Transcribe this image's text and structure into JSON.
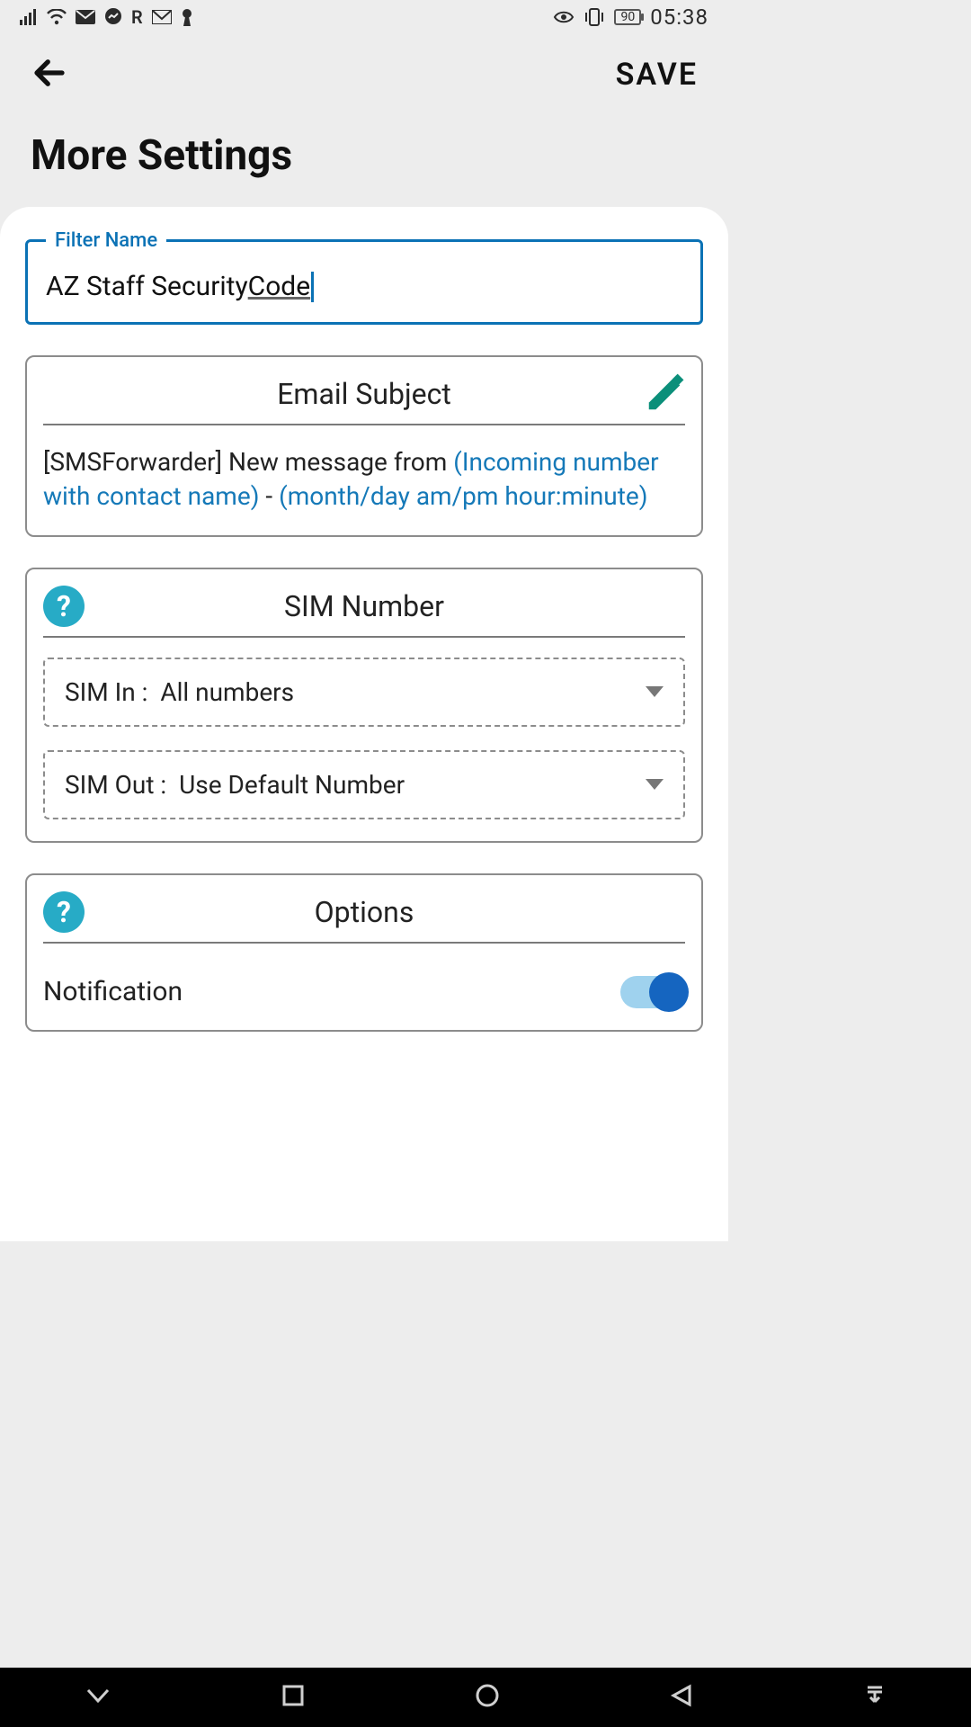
{
  "status_bar": {
    "battery": "90",
    "clock": "05:38",
    "roaming": "R"
  },
  "app_bar": {
    "save_label": "SAVE"
  },
  "page": {
    "title": "More Settings"
  },
  "filter": {
    "legend": "Filter Name",
    "value_prefix": "AZ Staff Security ",
    "value_underlined": "Code"
  },
  "email_subject": {
    "title": "Email Subject",
    "prefix": "[SMSForwarder] New message from ",
    "token1": "(Incoming number with contact name)",
    "sep": " - ",
    "token2": "(month/day am/pm hour:minute)"
  },
  "sim": {
    "title": "SIM Number",
    "in_label": "SIM In :",
    "in_value": "All numbers",
    "out_label": "SIM Out :",
    "out_value": "Use Default Number"
  },
  "options": {
    "title": "Options",
    "notification_label": "Notification",
    "notification_on": true
  }
}
